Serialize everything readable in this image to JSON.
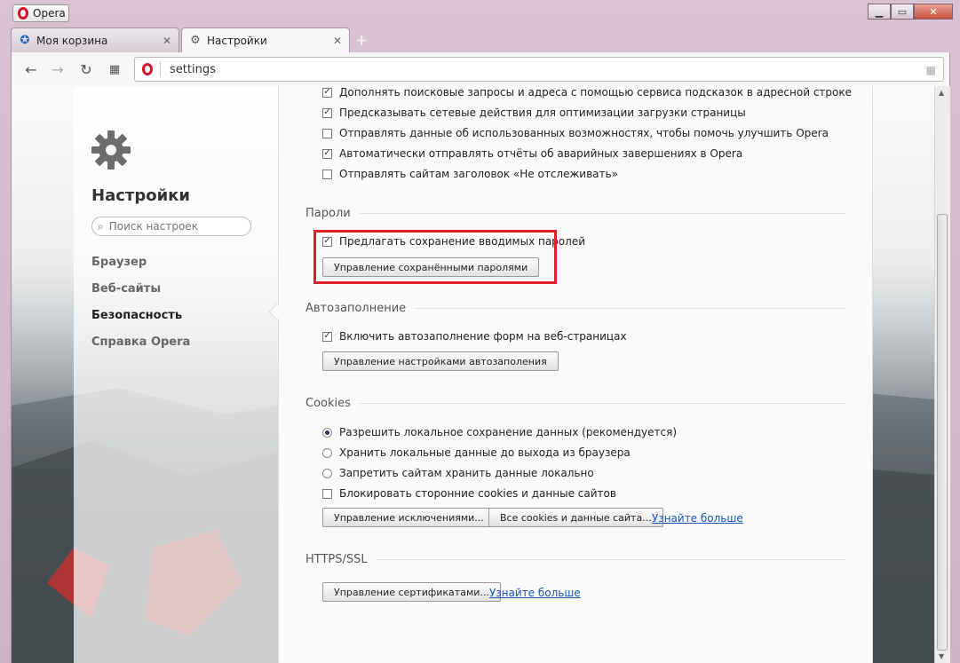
{
  "window": {
    "menu_label": "Opera",
    "colors": {
      "opera_red": "#d3132a",
      "link": "#1a55b8",
      "highlight": "#e0202a"
    }
  },
  "tabs": [
    {
      "label": "Моя корзина",
      "icon": "cart-site-icon",
      "active": false
    },
    {
      "label": "Настройки",
      "icon": "gear-icon",
      "active": true
    }
  ],
  "address": {
    "value": "settings"
  },
  "sidebar": {
    "title": "Настройки",
    "search_placeholder": "Поиск настроек",
    "items": [
      {
        "label": "Браузер",
        "active": false
      },
      {
        "label": "Веб-сайты",
        "active": false
      },
      {
        "label": "Безопасность",
        "active": true
      },
      {
        "label": "Справка Opera",
        "active": false
      }
    ]
  },
  "privacy": {
    "options": [
      {
        "label": "Дополнять поисковые запросы и адреса с помощью сервиса подсказок в адресной строке",
        "checked": true
      },
      {
        "label": "Предсказывать сетевые действия для оптимизации загрузки страницы",
        "checked": true
      },
      {
        "label": "Отправлять данные об использованных возможностях, чтобы помочь улучшить Opera",
        "checked": false
      },
      {
        "label": "Автоматически отправлять отчёты об аварийных завершениях в Opera",
        "checked": true
      },
      {
        "label": "Отправлять сайтам заголовок «Не отслеживать»",
        "checked": false
      }
    ]
  },
  "passwords": {
    "heading": "Пароли",
    "offer_save": {
      "label": "Предлагать сохранение вводимых паролей",
      "checked": true
    },
    "manage_button": "Управление сохранёнными паролями"
  },
  "autofill": {
    "heading": "Автозаполнение",
    "enable": {
      "label": "Включить автозаполнение форм на веб-страницах",
      "checked": true
    },
    "manage_button": "Управление настройками автозаполения"
  },
  "cookies": {
    "heading": "Cookies",
    "radios": [
      {
        "label": "Разрешить локальное сохранение данных (рекомендуется)",
        "selected": true
      },
      {
        "label": "Хранить локальные данные до выхода из браузера",
        "selected": false
      },
      {
        "label": "Запретить сайтам хранить данные локально",
        "selected": false
      }
    ],
    "block_third_party": {
      "label": "Блокировать сторонние cookies и данные сайтов",
      "checked": false
    },
    "exceptions_button": "Управление исключениями...",
    "all_cookies_button": "Все cookies и данные сайта...",
    "learn_more": "Узнайте больше"
  },
  "https": {
    "heading": "HTTPS/SSL",
    "certs_button": "Управление сертификатами...",
    "learn_more": "Узнайте больше"
  }
}
